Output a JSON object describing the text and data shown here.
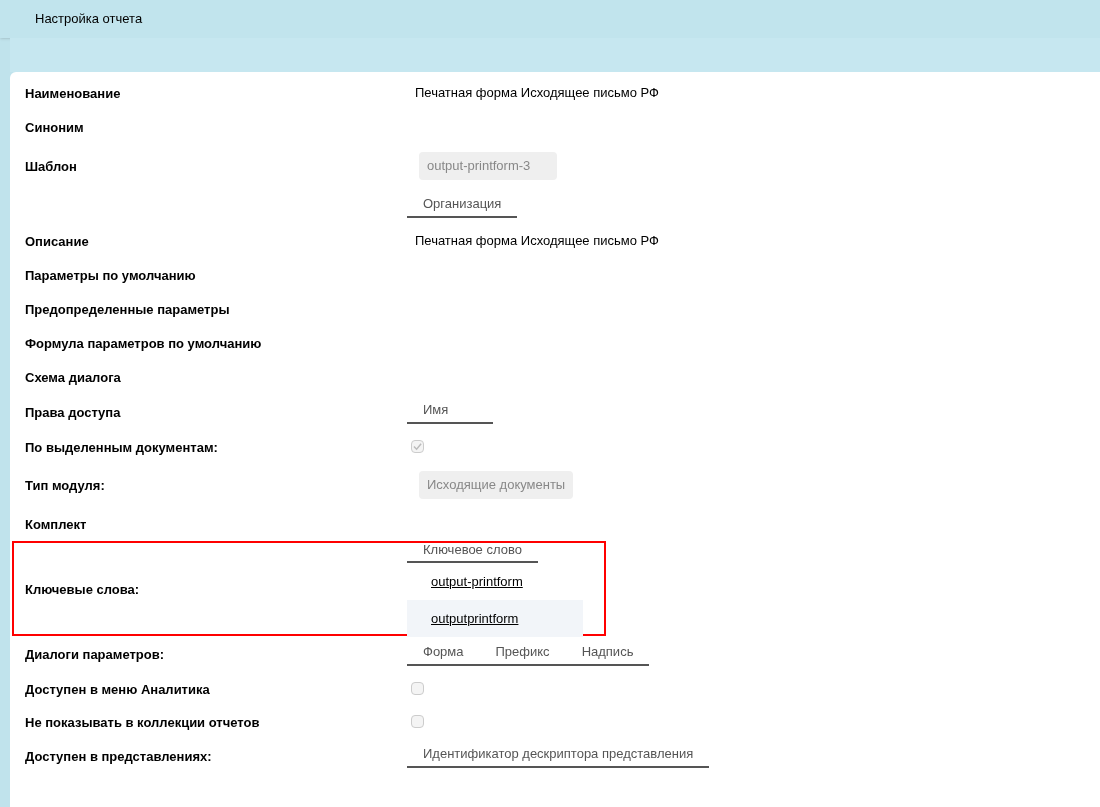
{
  "header": {
    "title": "Настройка отчета"
  },
  "rows": [
    {
      "kind": "text",
      "label": "Наименование",
      "value": "Печатная форма Исходящее письмо РФ"
    },
    {
      "kind": "empty",
      "label": "Синоним"
    },
    {
      "kind": "field",
      "label": "Шаблон",
      "value": "output-printform-3"
    },
    {
      "kind": "table",
      "columns": [
        "Организация"
      ]
    },
    {
      "kind": "text",
      "label": "Описание",
      "value": "Печатная форма Исходящее письмо РФ"
    },
    {
      "kind": "empty",
      "label": "Параметры по умолчанию"
    },
    {
      "kind": "empty",
      "label": "Предопределенные параметры"
    },
    {
      "kind": "empty",
      "label": "Формула параметров по умолчанию"
    },
    {
      "kind": "empty",
      "label": "Схема диалога"
    },
    {
      "kind": "table",
      "label": "Права доступа",
      "columns": [
        "Имя"
      ]
    },
    {
      "kind": "checkbox",
      "label": "По выделенным документам:",
      "checked": true
    },
    {
      "kind": "field",
      "label": "Тип модуля:",
      "value": "Исходящие документы"
    },
    {
      "kind": "empty",
      "label": "Комплект"
    },
    {
      "kind": "keywords",
      "label": "Ключевые слова:",
      "highlighted": true,
      "columns": [
        "Ключевое слово"
      ],
      "items": [
        {
          "text": "output-printform",
          "selected": false
        },
        {
          "text": "outputprintform",
          "selected": true
        }
      ]
    },
    {
      "kind": "table",
      "label": "Диалоги параметров:",
      "columns": [
        "Форма",
        "Префикс",
        "Надпись"
      ]
    },
    {
      "kind": "checkbox",
      "label": "Доступен в меню Аналитика",
      "checked": false
    },
    {
      "kind": "checkbox",
      "label": "Не показывать в коллекции отчетов",
      "checked": false
    },
    {
      "kind": "table",
      "label": "Доступен в представлениях:",
      "columns": [
        "Идентификатор дескриптора представления"
      ]
    }
  ]
}
